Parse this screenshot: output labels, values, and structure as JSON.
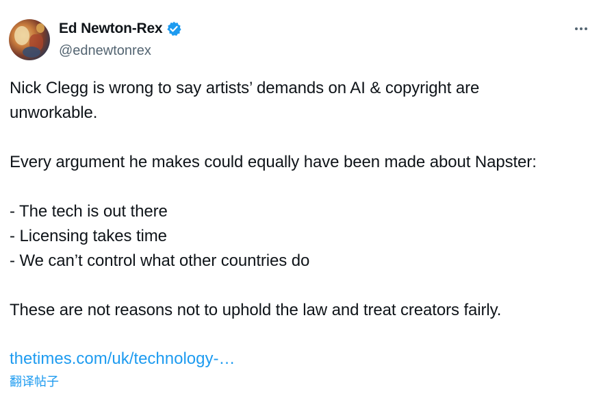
{
  "author": {
    "display_name": "Ed Newton-Rex",
    "handle": "@ednewtonrex",
    "verified": true
  },
  "tweet": {
    "lines": [
      "Nick Clegg is wrong to say artists’ demands on AI & copyright are",
      "unworkable.",
      "",
      "Every argument he makes could equally have been made about Napster:",
      "",
      "- The tech is out there",
      "- Licensing takes time",
      "- We can’t control what other countries do",
      "",
      "These are not reasons not to uphold the law and treat creators fairly."
    ],
    "link_text": "thetimes.com/uk/technology-…",
    "translate_label": "翻译帖子"
  },
  "colors": {
    "text": "#0f1419",
    "secondary": "#536471",
    "accent": "#1d9bf0"
  },
  "icons": {
    "verified": "verified-badge-icon",
    "more": "more-options-icon"
  }
}
